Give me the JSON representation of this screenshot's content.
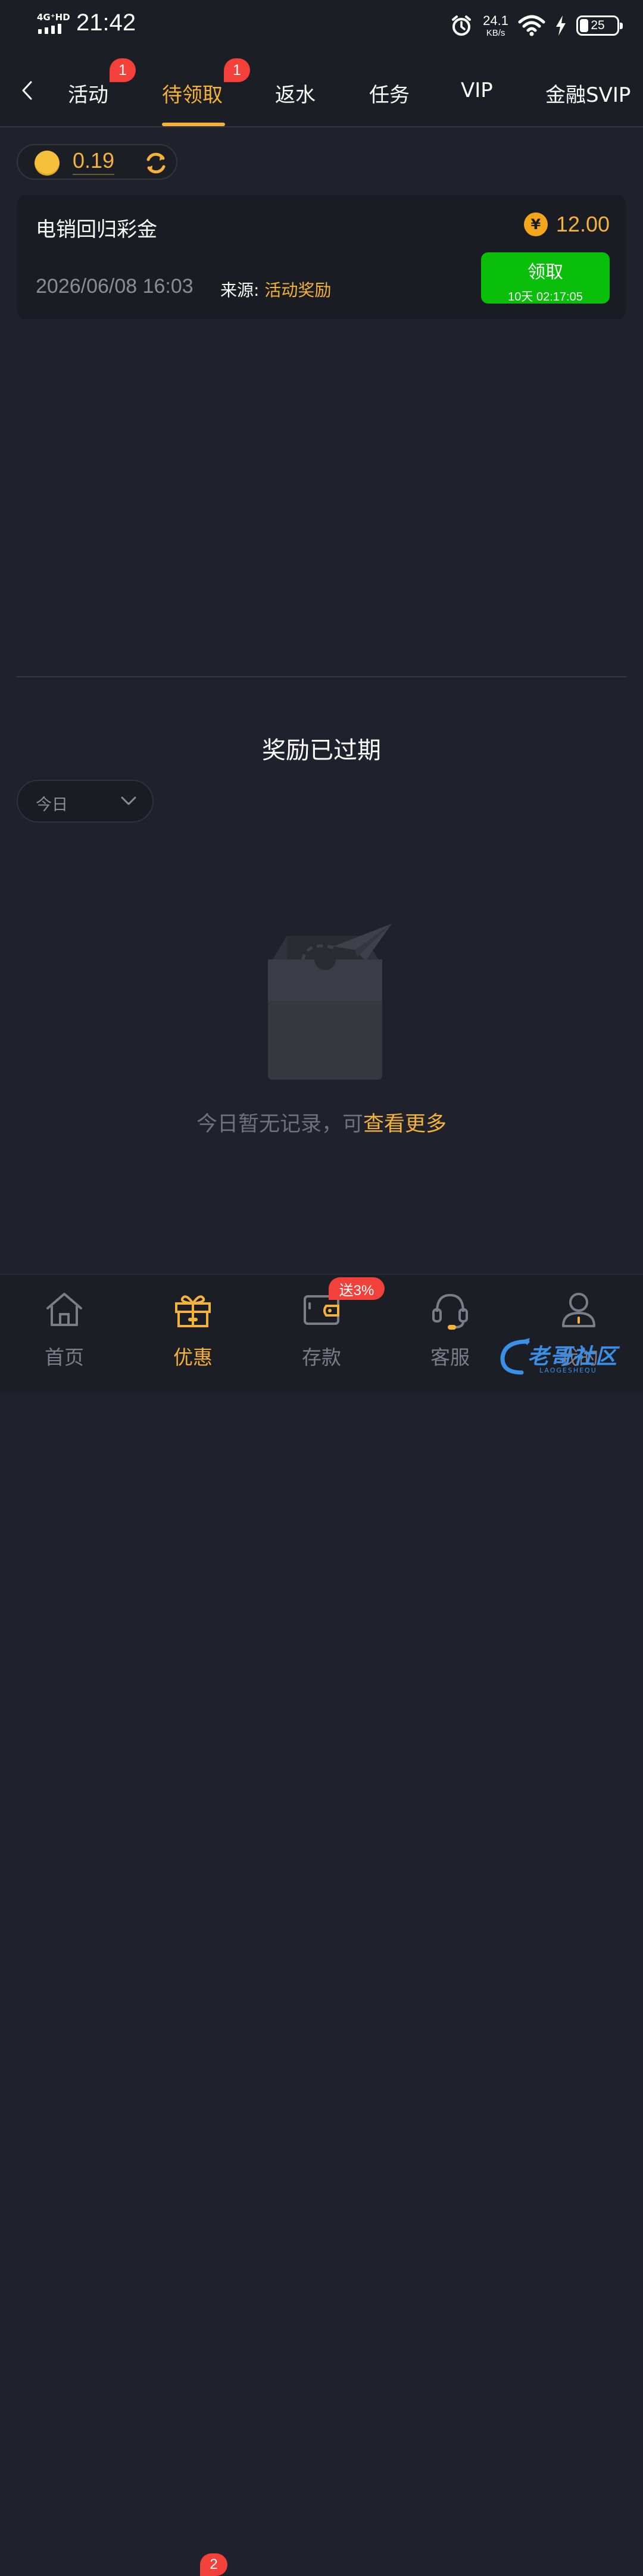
{
  "status_bar": {
    "network": "4G⁺HD",
    "time": "21:42",
    "speed_value": "24.1",
    "speed_unit": "KB/s",
    "battery": "25"
  },
  "tabs": [
    {
      "label": "活动",
      "badge": "1",
      "active": false
    },
    {
      "label": "待领取",
      "badge": "1",
      "active": true
    },
    {
      "label": "返水",
      "badge": "",
      "active": false
    },
    {
      "label": "任务",
      "badge": "",
      "active": false
    },
    {
      "label": "VIP",
      "badge": "",
      "active": false
    },
    {
      "label": "金融SVIP",
      "badge": "",
      "active": false
    }
  ],
  "balance": {
    "value": "0.19"
  },
  "reward_card": {
    "title": "电销回归彩金",
    "currency_symbol": "¥",
    "amount": "12.00",
    "date": "2026/06/08 16:03",
    "source_label": "来源:",
    "source_value": "活动奖励",
    "claim_label": "领取",
    "countdown": "10天 02:17:05"
  },
  "expired_section": {
    "title": "奖励已过期",
    "filter_value": "今日",
    "empty_text": "今日暂无记录，可",
    "empty_link": "查看更多"
  },
  "bottom_nav": [
    {
      "label": "首页",
      "icon": "home-icon",
      "active": false,
      "badge": ""
    },
    {
      "label": "优惠",
      "icon": "gift-icon",
      "active": true,
      "badge": "2"
    },
    {
      "label": "存款",
      "icon": "wallet-icon",
      "active": false,
      "badge": "送3%"
    },
    {
      "label": "客服",
      "icon": "headset-icon",
      "active": false,
      "badge": ""
    },
    {
      "label": "我的",
      "icon": "user-icon",
      "active": false,
      "badge": ""
    }
  ],
  "watermark": {
    "text": "老哥社区",
    "sub": "LAOGESHEQU"
  },
  "colors": {
    "background": "#1f222c",
    "accent": "#f4b23a",
    "claim_green": "#0abf0a",
    "badge_red": "#f2403b"
  }
}
